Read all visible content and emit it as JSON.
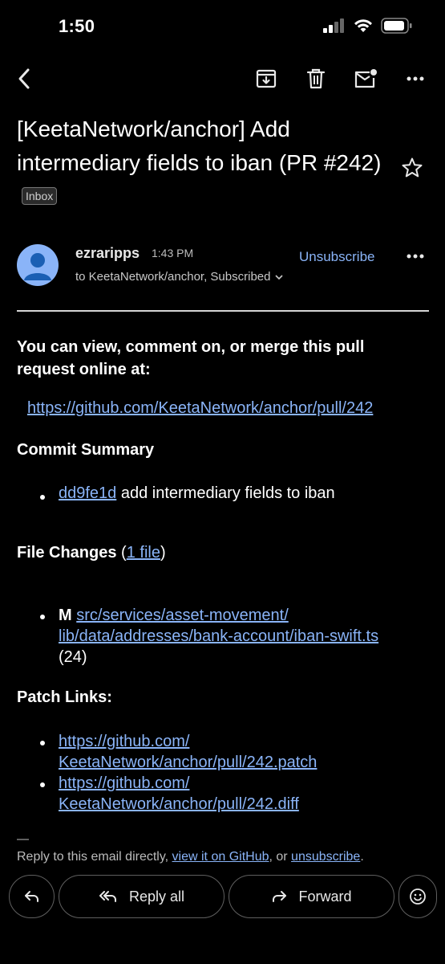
{
  "status": {
    "time": "1:50"
  },
  "toolbar": {
    "back_icon": "chevron-left-icon",
    "archive_icon": "archive-icon",
    "delete_icon": "trash-icon",
    "unread_icon": "mark-unread-icon",
    "more_icon": "more-horizontal-icon"
  },
  "email": {
    "subject": "[KeetaNetwork/anchor] Add intermediary fields to iban (PR #242)",
    "label": "Inbox",
    "sender": {
      "name": "ezraripps",
      "time": "1:43 PM",
      "recipients": "to KeetaNetwork/anchor, Subscribed"
    },
    "unsubscribe": "Unsubscribe",
    "body": {
      "intro": "You can view, comment on, or merge this pull request online at:",
      "pr_url": "https://github.com/KeetaNetwork/anchor/pull/242",
      "commit_heading": "Commit Summary",
      "commit": {
        "hash": "dd9fe1d",
        "message": " add intermediary fields to iban"
      },
      "files_heading": "File Changes",
      "files_open": " (",
      "files_link": "1 file",
      "files_close": ")",
      "file": {
        "status": "M",
        "path_1": "src/services/asset-movement/",
        "path_2": "lib/data/addresses/bank-account/iban-swift.ts",
        "changes": "(24)"
      },
      "patch_heading": "Patch Links:",
      "patches": [
        {
          "line1": "https://github.com/",
          "line2": "KeetaNetwork/anchor/pull/242.patch"
        },
        {
          "line1": "https://github.com/",
          "line2": "KeetaNetwork/anchor/pull/242.diff"
        }
      ]
    },
    "footer": {
      "dash": "—",
      "text_1": "Reply to this email directly, ",
      "link_1": "view it on GitHub",
      "text_2": ", or ",
      "link_2": "unsubscribe",
      "text_3": "."
    }
  },
  "actions": {
    "reply_all": "Reply all",
    "forward": "Forward"
  },
  "colors": {
    "accent": "#8ab4f8",
    "background": "#000000"
  }
}
